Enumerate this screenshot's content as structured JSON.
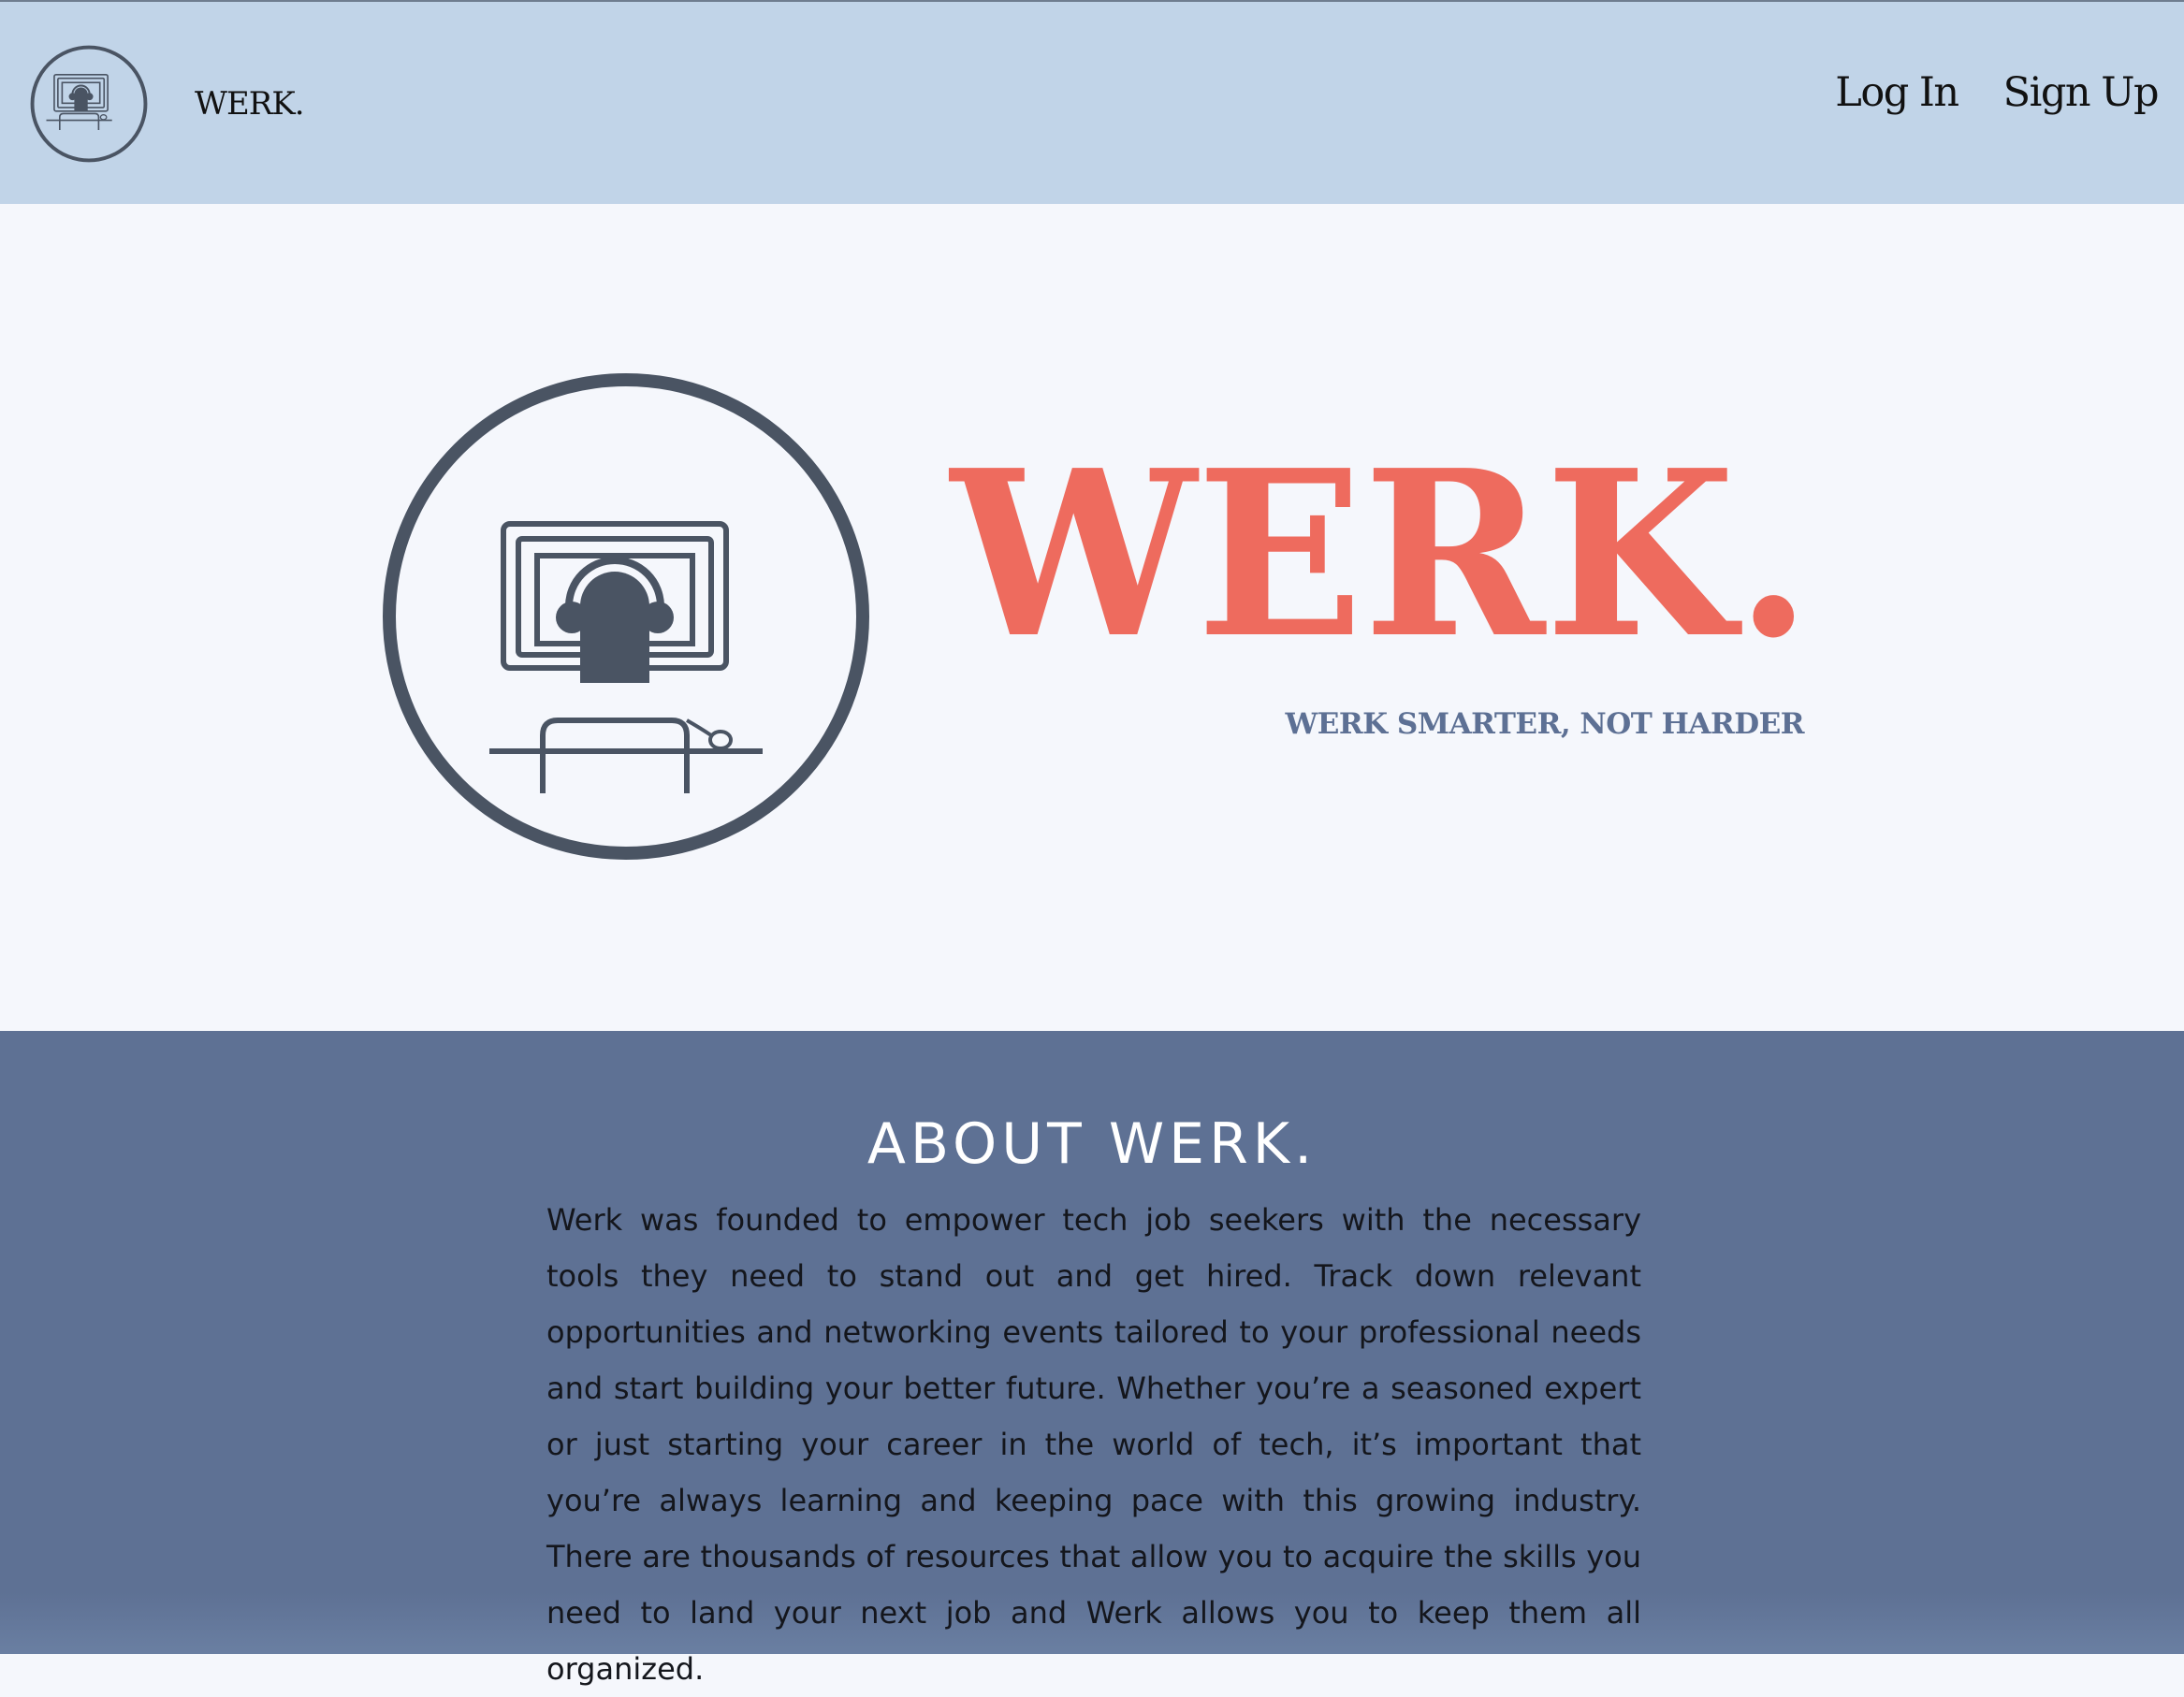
{
  "navbar": {
    "brand_text": "WERK.",
    "logo_icon": "computer-user-icon",
    "links": [
      {
        "label": "Log In"
      },
      {
        "label": "Sign Up"
      }
    ]
  },
  "hero": {
    "title": "WERK.",
    "tagline": "WERK SMARTER, NOT HARDER",
    "logo_icon": "computer-user-icon"
  },
  "about": {
    "title": "ABOUT WERK.",
    "paragraph": "Werk was founded to empower tech job seekers with the necessary tools they need to stand out and get hired. Track down relevant opportunities and networking events tailored to your professional needs and start building your better future. Whether you’re a seasoned expert or just starting your career in the world of tech, it’s important that you’re always learning and keeping pace with this growing industry. There are thousands of resources that allow you to acquire the skills you need to land your next job and Werk allows you to keep them all organized."
  },
  "colors": {
    "navbar_bg": "#c1d4e8",
    "hero_bg": "#f5f7fc",
    "accent_coral": "#ee6b5e",
    "tagline_blue": "#5d7094",
    "about_bg": "#5e7194",
    "icon_dark": "#4a5463"
  }
}
